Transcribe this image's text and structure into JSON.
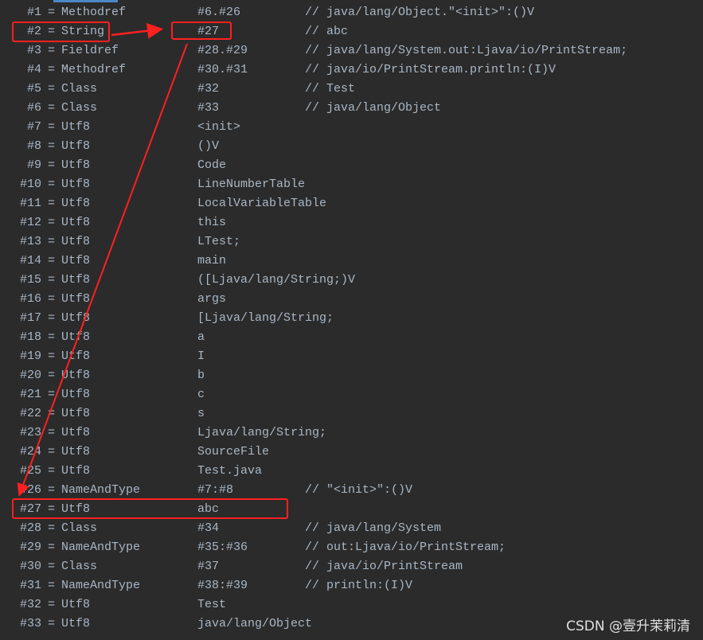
{
  "constant_pool": [
    {
      "index": "#1",
      "type": "Methodref",
      "value": "#6.#26",
      "comment": "// java/lang/Object.\"<init>\":()V"
    },
    {
      "index": "#2",
      "type": "String",
      "value": "#27",
      "comment": "// abc"
    },
    {
      "index": "#3",
      "type": "Fieldref",
      "value": "#28.#29",
      "comment": "// java/lang/System.out:Ljava/io/PrintStream;"
    },
    {
      "index": "#4",
      "type": "Methodref",
      "value": "#30.#31",
      "comment": "// java/io/PrintStream.println:(I)V"
    },
    {
      "index": "#5",
      "type": "Class",
      "value": "#32",
      "comment": "// Test"
    },
    {
      "index": "#6",
      "type": "Class",
      "value": "#33",
      "comment": "// java/lang/Object"
    },
    {
      "index": "#7",
      "type": "Utf8",
      "value": "<init>",
      "comment": ""
    },
    {
      "index": "#8",
      "type": "Utf8",
      "value": "()V",
      "comment": ""
    },
    {
      "index": "#9",
      "type": "Utf8",
      "value": "Code",
      "comment": ""
    },
    {
      "index": "#10",
      "type": "Utf8",
      "value": "LineNumberTable",
      "comment": ""
    },
    {
      "index": "#11",
      "type": "Utf8",
      "value": "LocalVariableTable",
      "comment": ""
    },
    {
      "index": "#12",
      "type": "Utf8",
      "value": "this",
      "comment": ""
    },
    {
      "index": "#13",
      "type": "Utf8",
      "value": "LTest;",
      "comment": ""
    },
    {
      "index": "#14",
      "type": "Utf8",
      "value": "main",
      "comment": ""
    },
    {
      "index": "#15",
      "type": "Utf8",
      "value": "([Ljava/lang/String;)V",
      "comment": ""
    },
    {
      "index": "#16",
      "type": "Utf8",
      "value": "args",
      "comment": ""
    },
    {
      "index": "#17",
      "type": "Utf8",
      "value": "[Ljava/lang/String;",
      "comment": ""
    },
    {
      "index": "#18",
      "type": "Utf8",
      "value": "a",
      "comment": ""
    },
    {
      "index": "#19",
      "type": "Utf8",
      "value": "I",
      "comment": ""
    },
    {
      "index": "#20",
      "type": "Utf8",
      "value": "b",
      "comment": ""
    },
    {
      "index": "#21",
      "type": "Utf8",
      "value": "c",
      "comment": ""
    },
    {
      "index": "#22",
      "type": "Utf8",
      "value": "s",
      "comment": ""
    },
    {
      "index": "#23",
      "type": "Utf8",
      "value": "Ljava/lang/String;",
      "comment": ""
    },
    {
      "index": "#24",
      "type": "Utf8",
      "value": "SourceFile",
      "comment": ""
    },
    {
      "index": "#25",
      "type": "Utf8",
      "value": "Test.java",
      "comment": ""
    },
    {
      "index": "#26",
      "type": "NameAndType",
      "value": "#7:#8",
      "comment": "// \"<init>\":()V"
    },
    {
      "index": "#27",
      "type": "Utf8",
      "value": "abc",
      "comment": ""
    },
    {
      "index": "#28",
      "type": "Class",
      "value": "#34",
      "comment": "// java/lang/System"
    },
    {
      "index": "#29",
      "type": "NameAndType",
      "value": "#35:#36",
      "comment": "// out:Ljava/io/PrintStream;"
    },
    {
      "index": "#30",
      "type": "Class",
      "value": "#37",
      "comment": "// java/io/PrintStream"
    },
    {
      "index": "#31",
      "type": "NameAndType",
      "value": "#38:#39",
      "comment": "// println:(I)V"
    },
    {
      "index": "#32",
      "type": "Utf8",
      "value": "Test",
      "comment": ""
    },
    {
      "index": "#33",
      "type": "Utf8",
      "value": "java/lang/Object",
      "comment": ""
    }
  ],
  "equals_sign": "=",
  "watermark": "CSDN @壹升茉莉清",
  "colors": {
    "background": "#2b2b2b",
    "text": "#a9b7c6",
    "annotation": "#ff2020",
    "tab_accent": "#4a88c7"
  }
}
